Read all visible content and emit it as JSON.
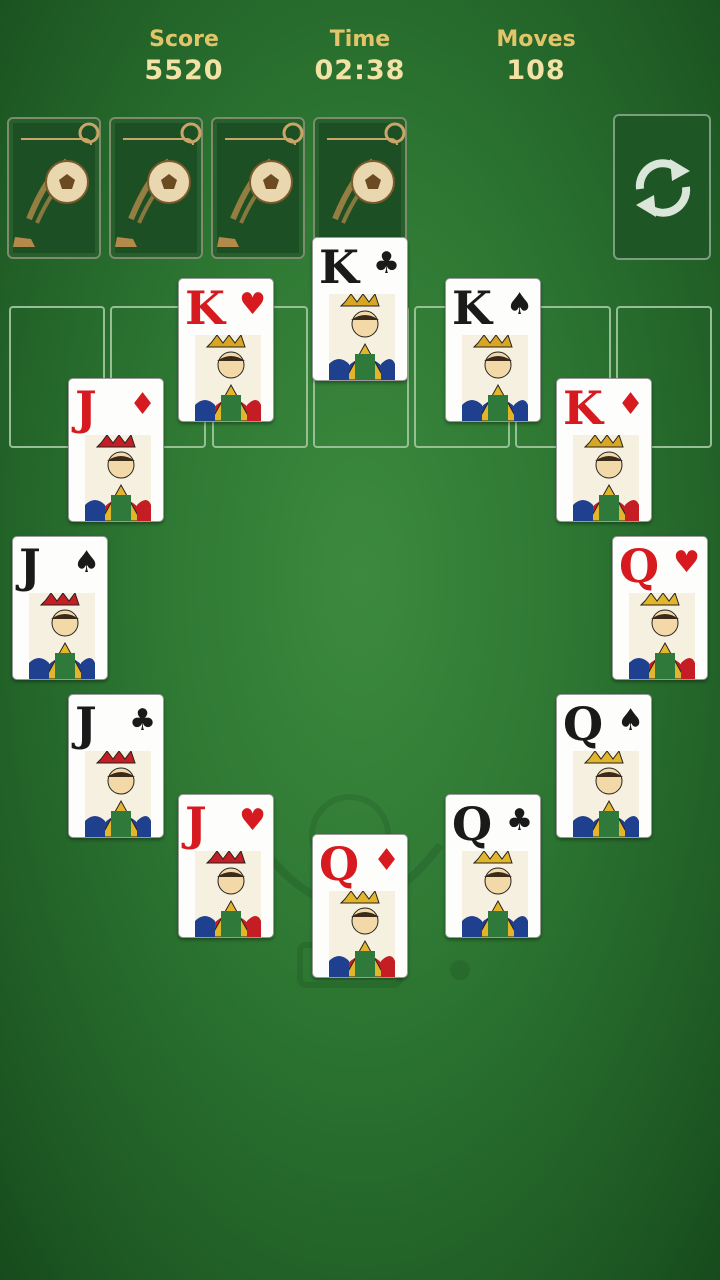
{
  "header": {
    "score_label": "Score",
    "score_value": "5520",
    "time_label": "Time",
    "time_value": "02:38",
    "moves_label": "Moves",
    "moves_value": "108"
  },
  "stock": {
    "card_back_icon": "soccer-ball-icon",
    "piles": 4
  },
  "actions": {
    "refresh_icon": "refresh-icon"
  },
  "tableau_cards": [
    {
      "rank": "K",
      "suit": "♣",
      "color": "black"
    },
    {
      "rank": "K",
      "suit": "♥",
      "color": "red"
    },
    {
      "rank": "K",
      "suit": "♠",
      "color": "black"
    },
    {
      "rank": "J",
      "suit": "♦",
      "color": "red"
    },
    {
      "rank": "K",
      "suit": "♦",
      "color": "red"
    },
    {
      "rank": "J",
      "suit": "♠",
      "color": "black"
    },
    {
      "rank": "Q",
      "suit": "♥",
      "color": "red"
    },
    {
      "rank": "J",
      "suit": "♣",
      "color": "black"
    },
    {
      "rank": "Q",
      "suit": "♠",
      "color": "black"
    },
    {
      "rank": "J",
      "suit": "♥",
      "color": "red"
    },
    {
      "rank": "Q",
      "suit": "♣",
      "color": "black"
    },
    {
      "rank": "Q",
      "suit": "♦",
      "color": "red"
    }
  ],
  "colors": {
    "felt": "#2e7833",
    "gold": "#e2c56a",
    "red_suit": "#d61a1f"
  }
}
